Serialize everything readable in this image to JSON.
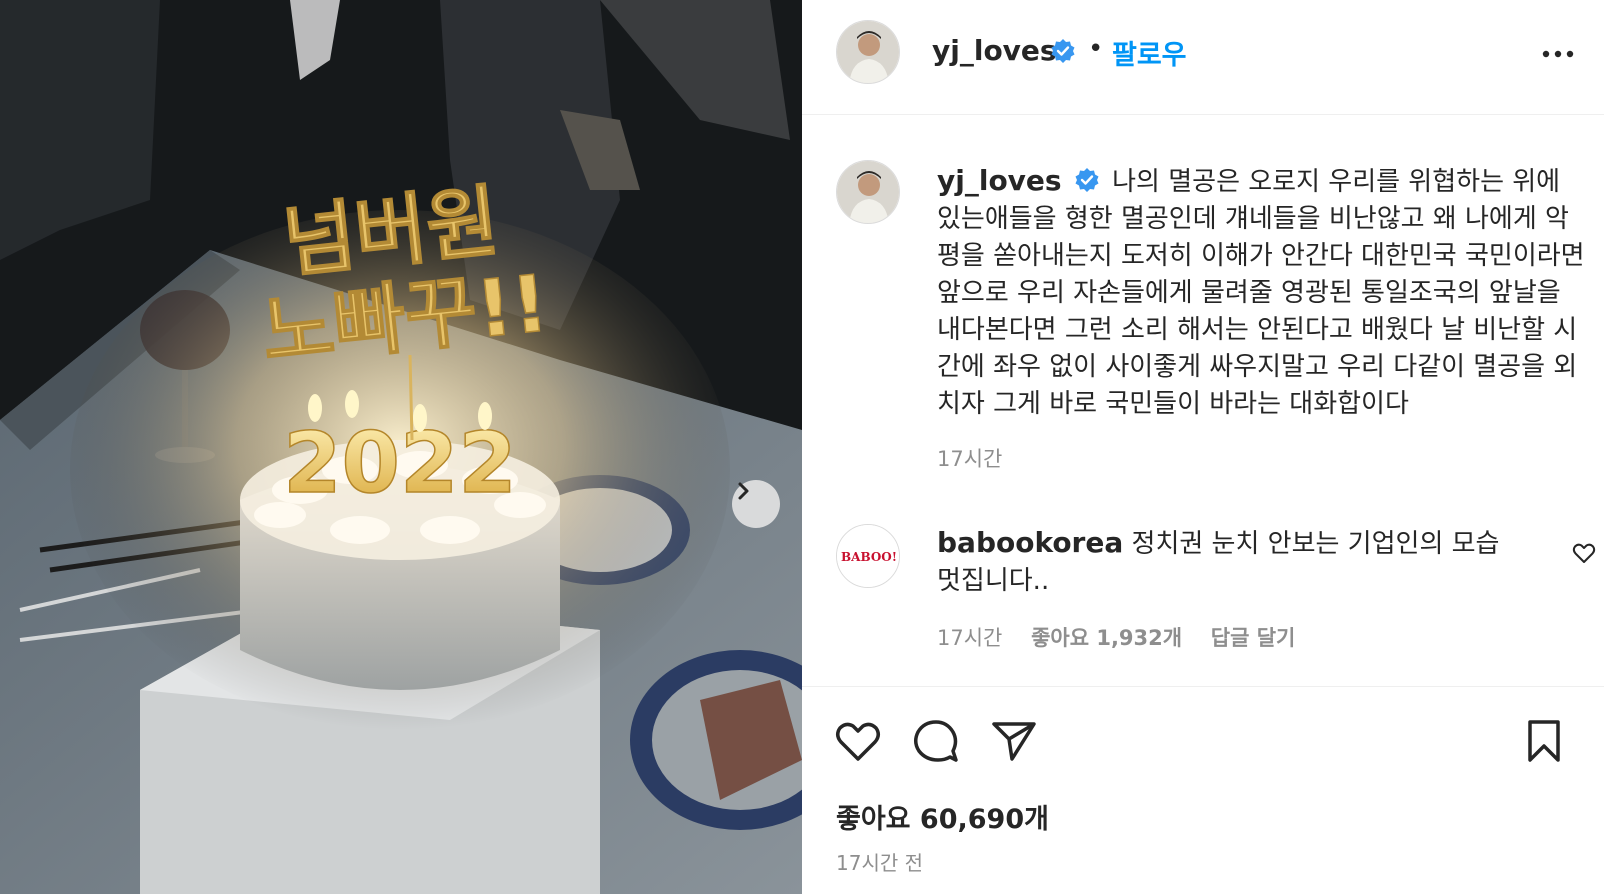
{
  "photo": {
    "topper_text_line1": "넘버원",
    "topper_text_line2": "노빠꾸!!",
    "candles_text": "2022"
  },
  "header": {
    "username": "yj_loves",
    "separator": "•",
    "follow_label": "팔로우"
  },
  "caption": {
    "username": "yj_loves",
    "text": "나의 멸공은 오로지 우리를 위협하는 위에 있는애들을 형한 멸공인데 걔네들을 비난않고 왜 나에게 악평을 쏟아내는지 도저히 이해가 안간다 대한민국 국민이라면 앞으로 우리 자손들에게 물려줄 영광된 통일조국의 앞날을 내다본다면 그런 소리 해서는 안된다고 배웠다 날 비난할 시간에 좌우 없이 사이좋게 싸우지말고 우리 다같이 멸공을 외치자 그게 바로 국민들이 바라는 대화합이다",
    "time": "17시간"
  },
  "comment": {
    "username": "babookorea",
    "avatar_logo": "BABOO!",
    "text": "정치권 눈치 안보는 기업인의 모습 멋집니다..",
    "time": "17시간",
    "likes": "좋아요 1,932개",
    "reply": "답글 달기"
  },
  "footer": {
    "likes": "좋아요 60,690개",
    "time": "17시간 전"
  },
  "colors": {
    "accent": "#0095f6",
    "verified": "#3897f0",
    "muted": "#8e8e8e"
  },
  "icons": [
    "more-icon",
    "verified-icon",
    "heart-icon",
    "comment-icon",
    "share-icon",
    "bookmark-icon",
    "chevron-right-icon"
  ]
}
